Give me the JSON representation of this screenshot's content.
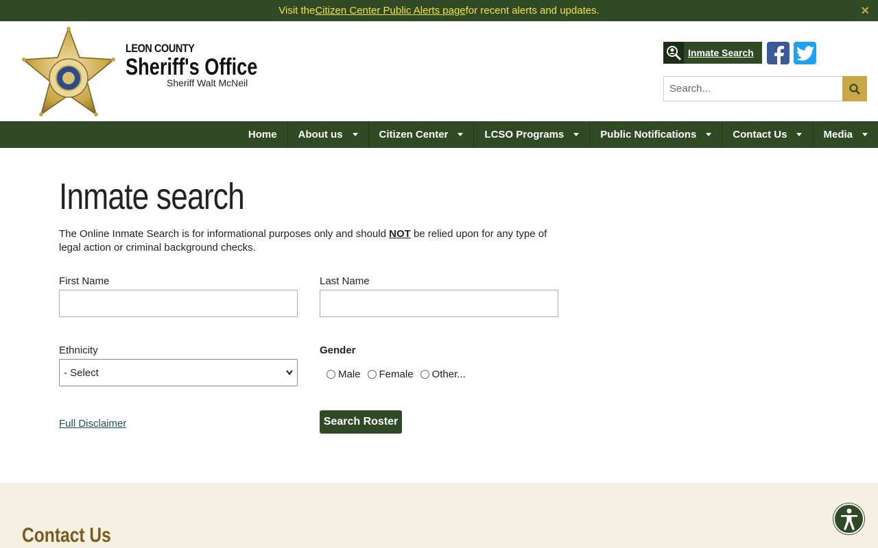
{
  "alert": {
    "prefix": "Visit the ",
    "link": "Citizen Center Public Alerts page",
    "suffix": " for recent alerts and updates.",
    "close": "✕"
  },
  "brand": {
    "county": "LEON COUNTY",
    "office": "Sheriff's Office",
    "sheriff": "Sheriff Walt McNeil"
  },
  "header": {
    "inmate_search": "Inmate Search",
    "search_placeholder": "Search..."
  },
  "nav": [
    {
      "label": "Home",
      "dropdown": false
    },
    {
      "label": "About us",
      "dropdown": true
    },
    {
      "label": "Citizen Center",
      "dropdown": true
    },
    {
      "label": "LCSO Programs",
      "dropdown": true
    },
    {
      "label": "Public Notifications",
      "dropdown": true
    },
    {
      "label": "Contact Us",
      "dropdown": true
    },
    {
      "label": "Media",
      "dropdown": true
    }
  ],
  "main": {
    "title": "Inmate search",
    "intro_before": "The Online Inmate Search is for informational purposes only and should ",
    "intro_not": "NOT",
    "intro_after": " be relied upon for any type of legal action or criminal background checks.",
    "first_name_label": "First Name",
    "last_name_label": "Last Name",
    "ethnicity_label": "Ethnicity",
    "ethnicity_value": "- Select",
    "gender_label": "Gender",
    "gender_options": [
      "Male",
      "Female",
      "Other..."
    ],
    "disclaimer": "Full Disclaimer",
    "submit": "Search Roster"
  },
  "footer": {
    "title": "Contact Us"
  },
  "colors": {
    "primary_green": "#2f4a24",
    "gold": "#c9a646",
    "alert_text": "#f2e14a",
    "footer_bg": "#f5f0e1"
  }
}
